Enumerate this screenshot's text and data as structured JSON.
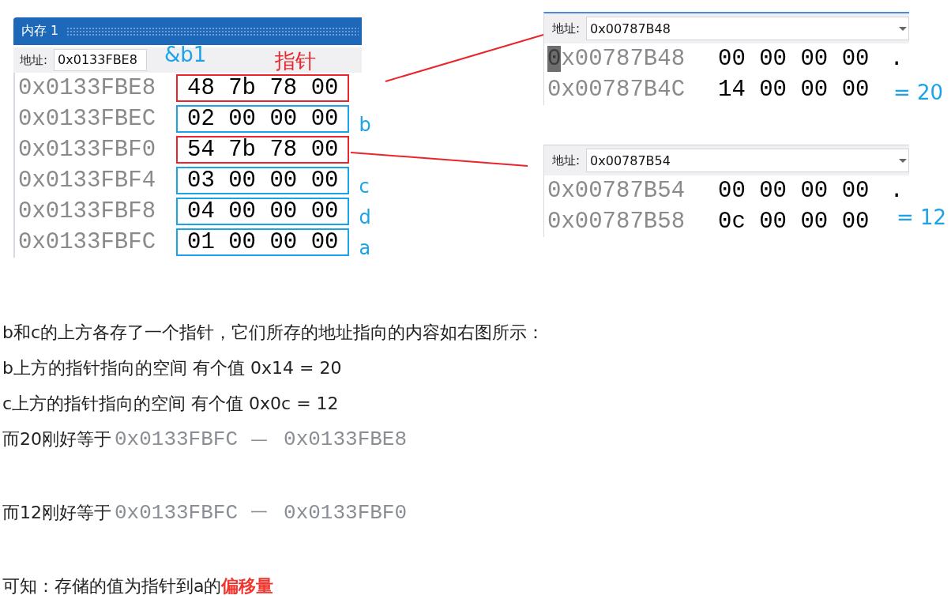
{
  "memory_window": {
    "title": "内存 1",
    "address_label": "地址:",
    "address": "0x0133FBE8",
    "rows": [
      {
        "address": "0x0133FBE8",
        "bytes": "48 7b 78 00",
        "color": "#e8262c"
      },
      {
        "address": "0x0133FBEC",
        "bytes": "02 00 00 00",
        "color": "#1aa3e8",
        "label": "b"
      },
      {
        "address": "0x0133FBF0",
        "bytes": "54 7b 78 00",
        "color": "#e8262c"
      },
      {
        "address": "0x0133FBF4",
        "bytes": "03 00 00 00",
        "color": "#1aa3e8",
        "label": "c"
      },
      {
        "address": "0x0133FBF8",
        "bytes": "04 00 00 00",
        "color": "#1aa3e8",
        "label": "d"
      },
      {
        "address": "0x0133FBFC",
        "bytes": "01 00 00 00",
        "color": "#1aa3e8",
        "label": "a"
      }
    ]
  },
  "annotations": [
    {
      "text": "&b1",
      "color": "#1aa3e8"
    },
    {
      "text": "指针",
      "color": "#e8262c"
    }
  ],
  "pointee_windows": [
    {
      "address_label": "地址:",
      "address": "0x00787B48",
      "rows": [
        {
          "address": "0x00787B48",
          "bytes": "00 00 00 00",
          "cursor": true,
          "trailing": "."
        },
        {
          "address": "0x00787B4C",
          "bytes": "14 00 00 00",
          "cursor": false
        }
      ],
      "note": "= 20"
    },
    {
      "address_label": "地址:",
      "address": "0x00787B54",
      "rows": [
        {
          "address": "0x00787B54",
          "bytes": "00 00 00 00",
          "cursor": false,
          "trailing": "."
        },
        {
          "address": "0x00787B58",
          "bytes": "0c 00 00 00",
          "cursor": false
        }
      ],
      "note": "= 12"
    }
  ],
  "paragraphs": [
    {
      "text": "b和c的上方各存了一个指针，它们所存的地址指向的内容如右图所示："
    },
    {
      "text": "b上方的指针指向的空间 有个值 0x14 = 20"
    },
    {
      "text": "c上方的指针指向的空间 有个值 0x0c = 12"
    },
    {
      "text": "而20刚好等于",
      "code": [
        "0x0133FBFC",
        "—",
        "0x0133FBE8"
      ]
    },
    {
      "text": "而12刚好等于",
      "code": [
        "0x0133FBFC",
        "一",
        "0x0133FBF0"
      ]
    },
    {
      "text": "可知：存储的值为指针到a的**偏移量**"
    }
  ]
}
